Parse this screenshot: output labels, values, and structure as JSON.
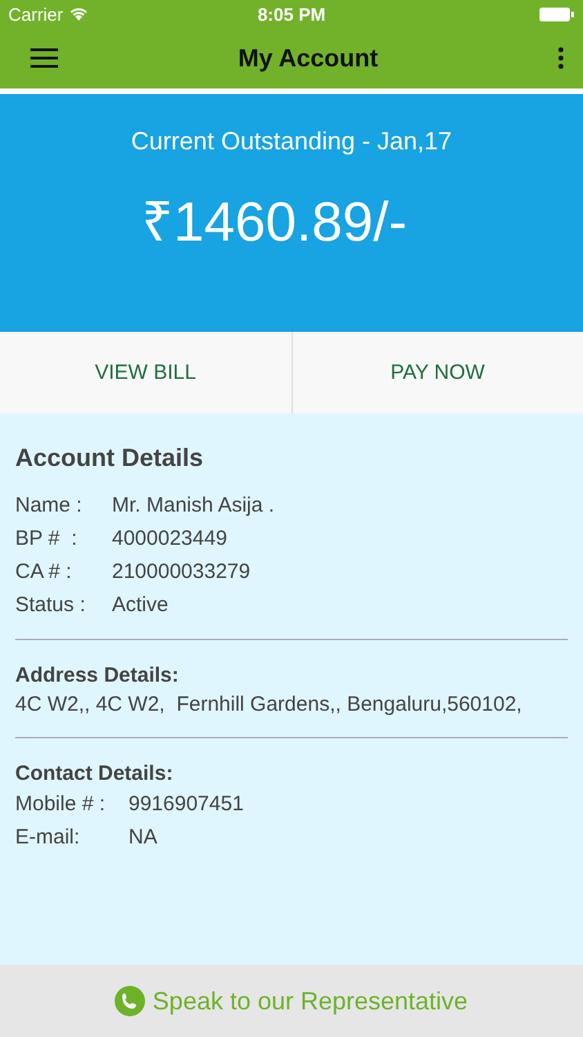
{
  "status_bar": {
    "carrier": "Carrier",
    "time": "8:05 PM"
  },
  "nav_bar": {
    "title": "My Account"
  },
  "outstanding": {
    "label": "Current Outstanding - Jan,17",
    "amount": "₹1460.89/-"
  },
  "actions": [
    "VIEW BILL",
    "PAY NOW"
  ],
  "account_details": {
    "title": "Account Details",
    "rows": [
      {
        "label": "Name :",
        "value": "Mr. Manish Asija ."
      },
      {
        "label": "BP #  :",
        "value": "4000023449"
      },
      {
        "label": "CA # :",
        "value": "210000033279"
      },
      {
        "label": "Status :",
        "value": "Active"
      }
    ]
  },
  "address_details": {
    "title": "Address Details:",
    "text": "4C W2,, 4C W2,  Fernhill Gardens,, Bengaluru,560102,"
  },
  "contact_details": {
    "title": "Contact Details:",
    "rows": [
      {
        "label": "Mobile # :",
        "value": "9916907451"
      },
      {
        "label": "E-mail:",
        "value": "NA"
      }
    ]
  },
  "footer": {
    "label": "Speak to our Representative"
  }
}
